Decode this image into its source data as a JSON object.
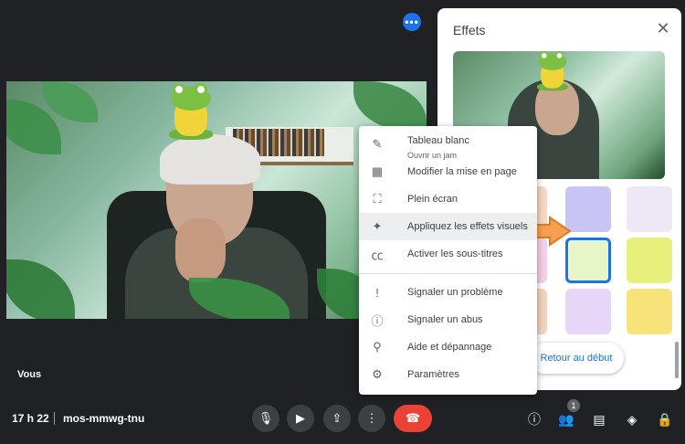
{
  "top_more_glyph": "•••",
  "video": {
    "self_label": "Vous"
  },
  "effects": {
    "title": "Effets",
    "close_glyph": "✕",
    "reset_label": "Retour au début",
    "tiles": [
      {
        "name": "tile-cup",
        "color": "#f6d7c2"
      },
      {
        "name": "tile-glass",
        "color": "#c8c4f4"
      },
      {
        "name": "tile-sloth",
        "color": "#ede7f6"
      },
      {
        "name": "tile-scene",
        "color": "#f3d0e6"
      },
      {
        "name": "tile-frog",
        "color": "#e8f5c8",
        "selected": true
      },
      {
        "name": "tile-elephant",
        "color": "#e7f07a"
      },
      {
        "name": "tile-dog",
        "color": "#f2d2c0"
      },
      {
        "name": "tile-cat",
        "color": "#e6d6f8"
      },
      {
        "name": "tile-robot",
        "color": "#f8e27a"
      }
    ]
  },
  "menu": {
    "items": [
      {
        "name": "menu-whiteboard",
        "label": "Tableau blanc",
        "sub": "Ouvrir un jam",
        "icon": "pencil-icon",
        "glyph": "✎"
      },
      {
        "name": "menu-layout",
        "label": "Modifier la mise en page",
        "icon": "layout-icon",
        "glyph": "▦"
      },
      {
        "name": "menu-fullscreen",
        "label": "Plein écran",
        "icon": "fullscreen-icon",
        "glyph": "⛶"
      },
      {
        "name": "menu-effects",
        "label": "Appliquez les effets visuels",
        "icon": "sparkle-icon",
        "glyph": "✦",
        "highlighted": true
      },
      {
        "name": "menu-captions",
        "label": "Activer les sous-titres",
        "icon": "captions-icon",
        "glyph": "㏄"
      },
      {
        "name": "menu-report-problem",
        "label": "Signaler un problème",
        "icon": "feedback-icon",
        "glyph": "!"
      },
      {
        "name": "menu-report-abuse",
        "label": "Signaler un abus",
        "icon": "alert-icon",
        "glyph": "ⓘ"
      },
      {
        "name": "menu-help",
        "label": "Aide et dépannage",
        "icon": "help-search-icon",
        "glyph": "⚲"
      },
      {
        "name": "menu-settings",
        "label": "Paramètres",
        "icon": "gear-icon",
        "glyph": "⚙"
      }
    ]
  },
  "bottom_bar": {
    "time": "17 h 22",
    "meeting_code": "mos-mmwg-tnu",
    "controls": [
      {
        "name": "mic-button",
        "icon": "mic-icon",
        "glyph": "🎙"
      },
      {
        "name": "camera-button",
        "icon": "camera-icon",
        "glyph": "▶"
      },
      {
        "name": "present-button",
        "icon": "present-icon",
        "glyph": "⇪"
      },
      {
        "name": "more-options-button",
        "icon": "more-vert-icon",
        "glyph": "⋮"
      },
      {
        "name": "end-call-button",
        "icon": "end-call-icon",
        "glyph": "☎"
      }
    ],
    "right_icons": [
      {
        "name": "meeting-details-button",
        "icon": "info-icon",
        "glyph": "ⓘ"
      },
      {
        "name": "people-button",
        "icon": "people-icon",
        "glyph": "👥"
      },
      {
        "name": "chat-button",
        "icon": "chat-icon",
        "glyph": "▤"
      },
      {
        "name": "activities-button",
        "icon": "shapes-icon",
        "glyph": "◈"
      },
      {
        "name": "host-controls-button",
        "icon": "lock-person-icon",
        "glyph": "🔒"
      }
    ],
    "people_count": "1"
  },
  "colors": {
    "accent": "#1a73e8",
    "end_call": "#ea4335",
    "background": "#202124"
  }
}
